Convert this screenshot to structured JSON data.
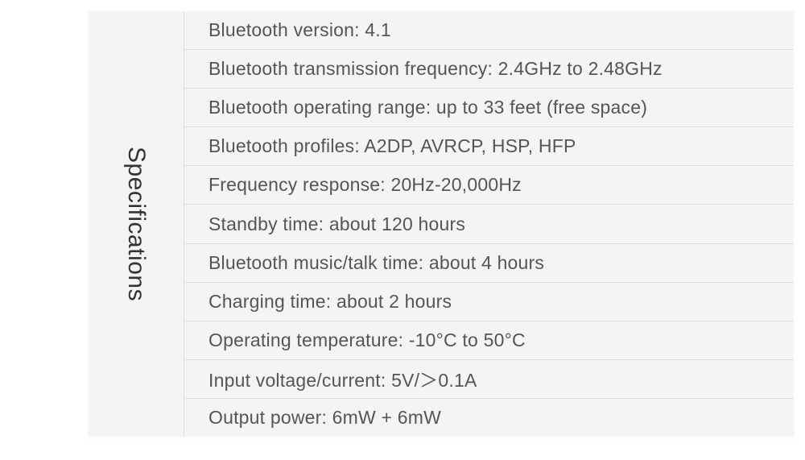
{
  "title": "Specifications",
  "specs": [
    "Bluetooth version: 4.1",
    "Bluetooth transmission frequency: 2.4GHz to 2.48GHz",
    "Bluetooth operating range: up to 33 feet (free space)",
    "Bluetooth profiles: A2DP, AVRCP, HSP, HFP",
    "Frequency response: 20Hz-20,000Hz",
    "Standby time: about 120 hours",
    "Bluetooth music/talk time: about 4 hours",
    "Charging time: about 2 hours",
    "Operating temperature: -10°C to 50°C",
    "Input voltage/current: 5V/＞0.1A",
    "Output power: 6mW + 6mW"
  ]
}
